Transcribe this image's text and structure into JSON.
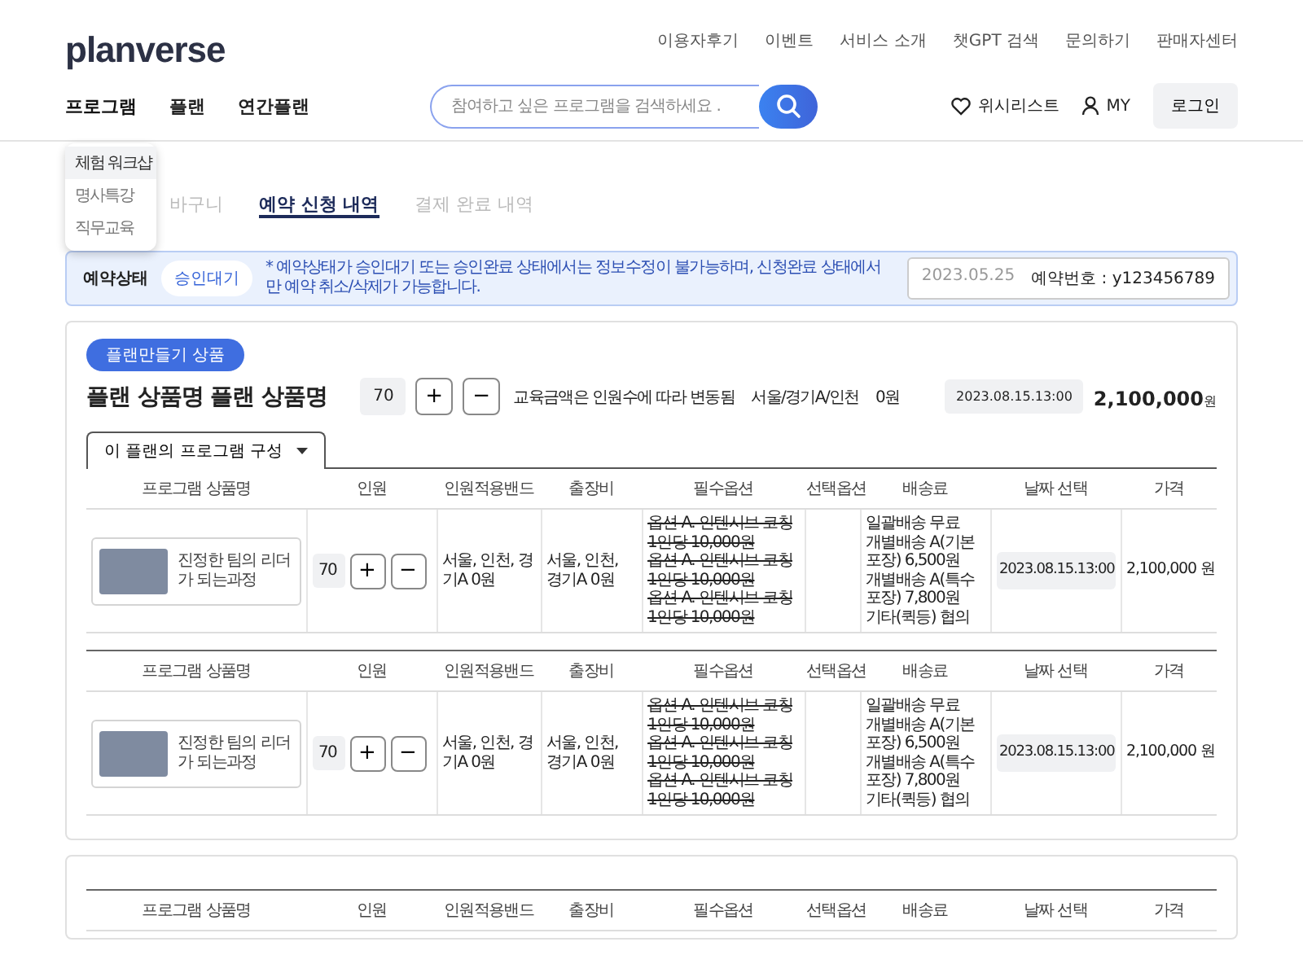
{
  "logo": {
    "text": "planverse"
  },
  "top_links": [
    "이용자후기",
    "이벤트",
    "서비스 소개",
    "챗GPT 검색",
    "문의하기",
    "판매자센터"
  ],
  "nav": [
    {
      "label": "프로그램",
      "selected": true
    },
    {
      "label": "플랜",
      "selected": false
    },
    {
      "label": "연간플랜",
      "selected": false
    }
  ],
  "search": {
    "placeholder": "참여하고 싶은 프로그램을 검색하세요 ."
  },
  "wishlist": "위시리스트",
  "my": "MY",
  "login": "로그인",
  "dropdown": [
    {
      "label": "체험 워크샵",
      "selected": true
    },
    {
      "label": "명사특강",
      "selected": false
    },
    {
      "label": "직무교육",
      "selected": false
    }
  ],
  "tabs": [
    {
      "label": "바구니",
      "selected": false
    },
    {
      "label": "예약 신청 내역",
      "selected": true
    },
    {
      "label": "결제 완료 내역",
      "selected": false
    }
  ],
  "status": {
    "label": "예약상태",
    "value": "승인대기",
    "notice": "* 예약상태가 승인대기 또는 승인완료 상태에서는 정보수정이 불가능하며, 신청완료 상태에서만 예약 취소/삭제가 가능합니다.",
    "date": "2023.05.25",
    "number": "예약번호 : y123456789"
  },
  "plan": {
    "badge": "플랜만들기 상품",
    "title": "플랜 상품명 플랜 상품명",
    "count": "70",
    "plus": "+",
    "minus": "−",
    "note": "교육금액은 인원수에 따라 변동됨",
    "region": "서울/경기A/인천",
    "fee": "0원",
    "date": "2023.08.15.13:00",
    "price": "2,100,000",
    "unit": "원",
    "tab": "이 플랜의 프로그램 구성"
  },
  "groups": [
    {
      "columns": [
        "프로그램 상품명",
        "인원",
        "인원적용밴드",
        "출장비",
        "필수옵션",
        "선택옵션",
        "배송료",
        "날짜 선택",
        "가격"
      ],
      "name": "진정한 팀의 리더가 되는과정",
      "count": "70",
      "plus": "+",
      "minus": "−",
      "band": "서울, 인천, 경기A 0원",
      "travel": "서울, 인천, 경기A 0원",
      "options": [
        "옵션 A. 인텐시브 코칭 1인당 10,000원",
        "옵션 A. 인텐시브 코칭 1인당 10,000원",
        "옵션 A. 인텐시브 코칭 1인당 10,000원"
      ],
      "delivery": [
        "일괄배송 무료",
        "개별배송 A(기본 포장) 6,500원",
        "개별배송 A(특수 포장) 7,800원",
        "기타(퀵등) 협의"
      ],
      "date": "2023.08.15.13:00",
      "price": "2,100,000 원"
    },
    {
      "columns": [
        "프로그램 상품명",
        "인원",
        "인원적용밴드",
        "출장비",
        "필수옵션",
        "선택옵션",
        "배송료",
        "날짜 선택",
        "가격"
      ],
      "name": "진정한 팀의 리더가 되는과정",
      "count": "70",
      "plus": "+",
      "minus": "−",
      "band": "서울, 인천, 경기A 0원",
      "travel": "서울, 인천, 경기A 0원",
      "options": [
        "옵션 A. 인텐시브 코칭 1인당 10,000원",
        "옵션 A. 인텐시브 코칭 1인당 10,000원",
        "옵션 A. 인텐시브 코칭 1인당 10,000원"
      ],
      "delivery": [
        "일괄배송 무료",
        "개별배송 A(기본 포장) 6,500원",
        "개별배송 A(특수 포장) 7,800원",
        "기타(퀵등) 협의"
      ],
      "date": "2023.08.15.13:00",
      "price": "2,100,000 원"
    }
  ],
  "second_card": {
    "columns": [
      "프로그램 상품명",
      "인원",
      "인원적용밴드",
      "출장비",
      "필수옵션",
      "선택옵션",
      "배송료",
      "날짜 선택",
      "가격"
    ]
  }
}
